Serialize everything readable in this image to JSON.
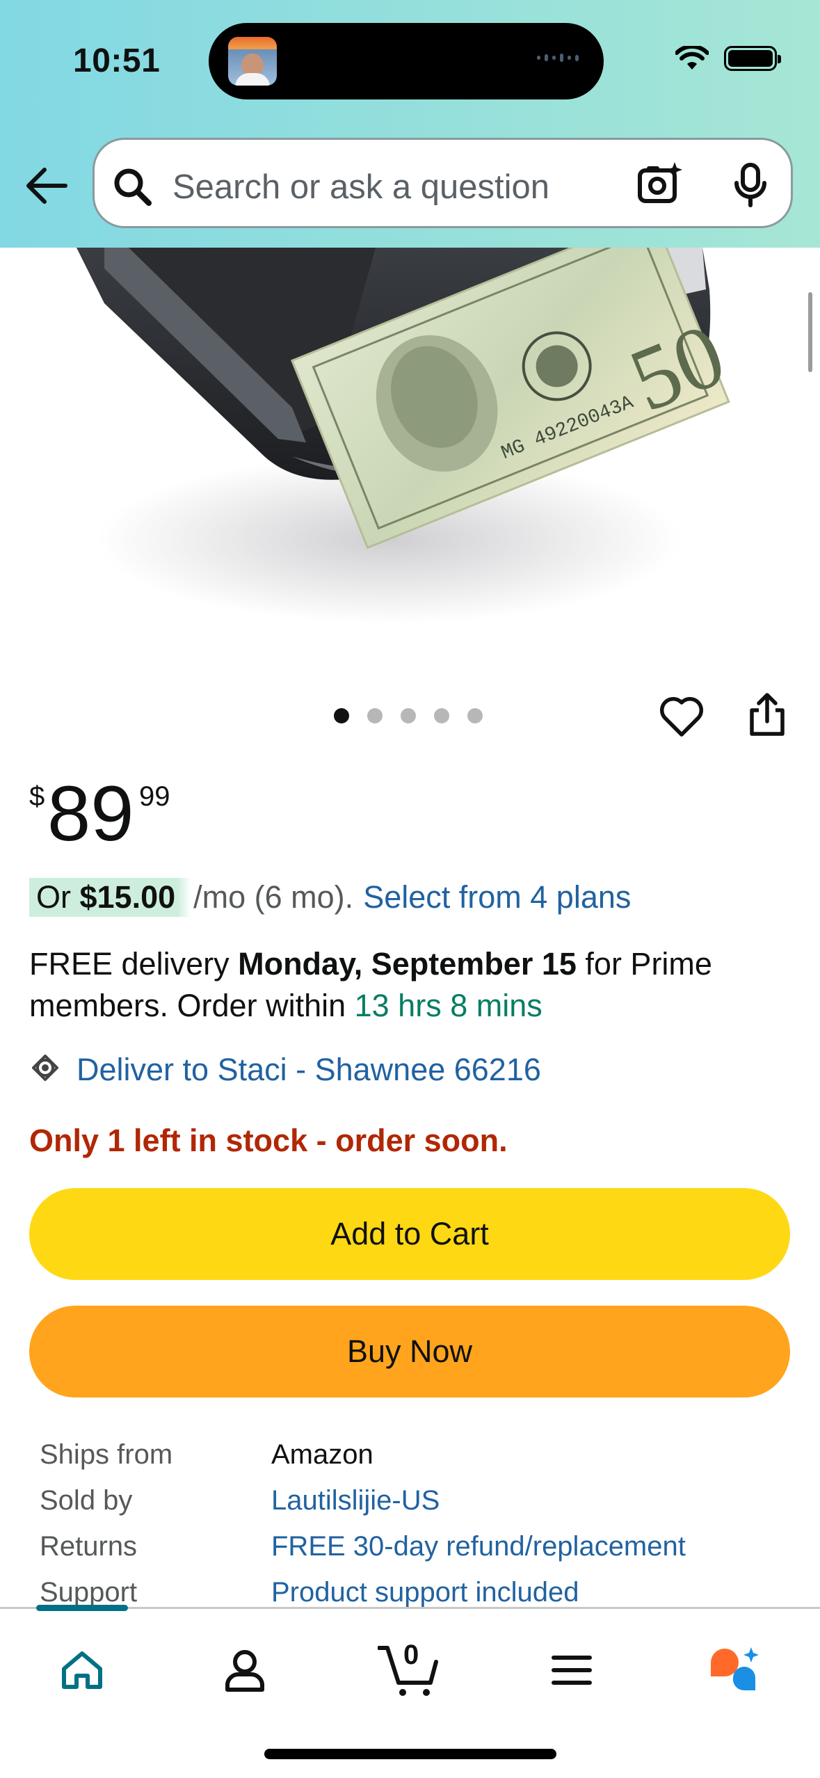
{
  "status_bar": {
    "time": "10:51"
  },
  "search": {
    "placeholder": "Search or ask a question"
  },
  "carousel": {
    "dot_count": 5,
    "active_index": 0
  },
  "product": {
    "price": {
      "currency": "$",
      "whole": "89",
      "fraction": "99"
    },
    "monthly": {
      "prefix": "Or ",
      "amount": "$15.00",
      "suffix": " /mo (6 mo).",
      "link": "Select from 4 plans"
    },
    "delivery": {
      "prefix": "FREE delivery ",
      "date": "Monday, September 15",
      "middle": " for Prime members. Order within ",
      "countdown": "13 hrs 8 mins"
    },
    "deliver_to": "Deliver to Staci - Shawnee 66216",
    "stock": "Only 1 left in stock - order soon.",
    "add_to_cart_label": "Add to Cart",
    "buy_now_label": "Buy Now",
    "details": [
      {
        "key": "Ships from",
        "value": "Amazon",
        "link": false
      },
      {
        "key": "Sold by",
        "value": "Lautilslijie-US",
        "link": true
      },
      {
        "key": "Returns",
        "value": "FREE 30-day refund/replacement",
        "link": true
      },
      {
        "key": "Support",
        "value": "Product support included",
        "link": true
      }
    ]
  },
  "bottom_nav": {
    "items": [
      "home-icon",
      "account-icon",
      "cart-icon",
      "menu-icon",
      "rufus-icon"
    ],
    "cart_count": "0",
    "active": "home-icon"
  },
  "colors": {
    "header_gradient_start": "#82d8e3",
    "header_gradient_end": "#a6e6d5",
    "link": "#2162a1",
    "green": "#067d62",
    "stock_red": "#b12704",
    "add_to_cart": "#ffd814",
    "buy_now": "#ffa41c",
    "nav_active": "#007185"
  }
}
